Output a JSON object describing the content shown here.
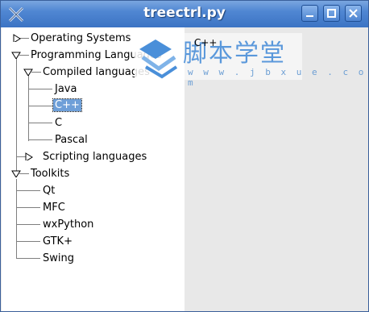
{
  "window": {
    "title": "treectrl.py"
  },
  "tree": [
    {
      "label": "Operating Systems",
      "expanded": false
    },
    {
      "label": "Programming Languages",
      "expanded": true
    },
    {
      "label": "Compiled languages",
      "expanded": true
    },
    {
      "label": "Java"
    },
    {
      "label": "C++",
      "selected": true
    },
    {
      "label": "C"
    },
    {
      "label": "Pascal"
    },
    {
      "label": "Scripting languages",
      "expanded": false
    },
    {
      "label": "Toolkits",
      "expanded": true
    },
    {
      "label": "Qt"
    },
    {
      "label": "MFC"
    },
    {
      "label": "wxPython"
    },
    {
      "label": "GTK+"
    },
    {
      "label": "Swing"
    }
  ],
  "detail": {
    "text": "C++"
  },
  "watermark": {
    "text": "脚本学堂",
    "url": "w w w . j b x u e . c o m"
  },
  "colors": {
    "titlebar": "#4f86d2",
    "selection": "#6e9fd8"
  }
}
